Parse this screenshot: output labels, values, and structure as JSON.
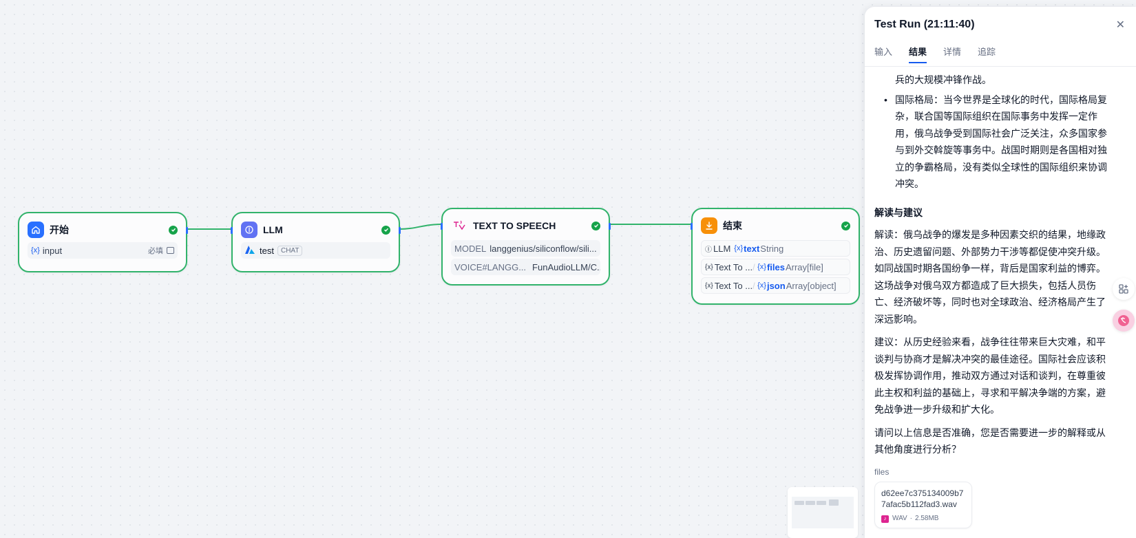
{
  "workflow": {
    "nodes": {
      "start": {
        "title": "开始",
        "var_symbol": "{x}",
        "var_name": "input",
        "required": "必填"
      },
      "llm": {
        "title": "LLM",
        "model": "test",
        "mode": "CHAT"
      },
      "tts": {
        "title": "TEXT TO SPEECH",
        "rows": [
          {
            "key": "MODEL",
            "value": "langgenius/siliconflow/sili..."
          },
          {
            "key": "VOICE#LANGG...",
            "value": "FunAudioLLM/C..."
          }
        ]
      },
      "end": {
        "title": "结束",
        "outputs": [
          {
            "source": "LLM",
            "symbol": "{x}",
            "name": "text",
            "type": "String"
          },
          {
            "source": "Text To ...",
            "symbol": "{x}",
            "name": "files",
            "type": "Array[file]"
          },
          {
            "source": "Text To ...",
            "symbol": "{x}",
            "name": "json",
            "type": "Array[object]"
          }
        ]
      }
    }
  },
  "panel": {
    "title": "Test Run (21:11:40)",
    "close_icon": "✕",
    "tabs": [
      "输入",
      "结果",
      "详情",
      "追踪"
    ],
    "active_tab": "结果",
    "result": {
      "continued_text": "兵的大规模冲锋作战。",
      "bullet_international": "国际格局：当今世界是全球化的时代，国际格局复杂，联合国等国际组织在国际事务中发挥一定作用，俄乌战争受到国际社会广泛关注，众多国家参与到外交斡旋等事务中。战国时期则是各国相对独立的争霸格局，没有类似全球性的国际组织来协调冲突。",
      "section_title": "解读与建议",
      "interpretation": "解读：俄乌战争的爆发是多种因素交织的结果，地缘政治、历史遗留问题、外部势力干涉等都促使冲突升级。如同战国时期各国纷争一样，背后是国家利益的博弈。这场战争对俄乌双方都造成了巨大损失，包括人员伤亡、经济破坏等，同时也对全球政治、经济格局产生了深远影响。",
      "suggestion": "建议：从历史经验来看，战争往往带来巨大灾难，和平谈判与协商才是解决冲突的最佳途径。国际社会应该积极发挥协调作用，推动双方通过对话和谈判，在尊重彼此主权和利益的基础上，寻求和平解决争端的方案，避免战争进一步升级和扩大化。",
      "question": "请问以上信息是否准确，您是否需要进一步的解释或从其他角度进行分析？"
    },
    "files_label": "files",
    "file": {
      "name": "d62ee7c375134009b77afac5b112fad3.wav",
      "type": "WAV",
      "size": "2.58MB"
    }
  },
  "colors": {
    "edge": "#31b36b",
    "accent": "#155aef",
    "start_icon": "#2970ff",
    "llm_icon": "#6172f3",
    "tts_icon": "#dd2590",
    "end_icon": "#f79009"
  }
}
